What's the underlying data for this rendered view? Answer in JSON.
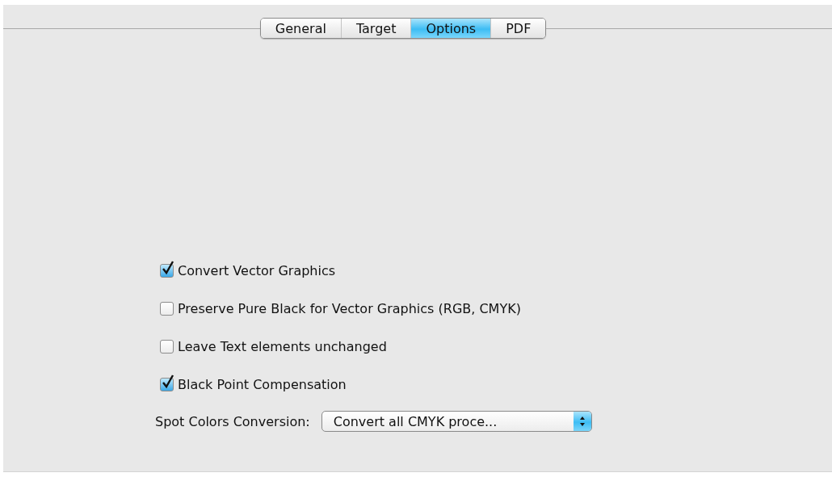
{
  "tabs": [
    {
      "label": "General",
      "selected": false
    },
    {
      "label": "Target",
      "selected": false
    },
    {
      "label": "Options",
      "selected": true
    },
    {
      "label": "PDF",
      "selected": false
    }
  ],
  "options": [
    {
      "label": "Convert Vector Graphics",
      "checked": true
    },
    {
      "label": "Preserve Pure Black for Vector Graphics (RGB, CMYK)",
      "checked": false
    },
    {
      "label": "Leave Text elements unchanged",
      "checked": false
    },
    {
      "label": "Black Point Compensation",
      "checked": true
    }
  ],
  "spot_colors": {
    "label": "Spot Colors Conversion:",
    "value": "Convert all CMYK proce..."
  }
}
